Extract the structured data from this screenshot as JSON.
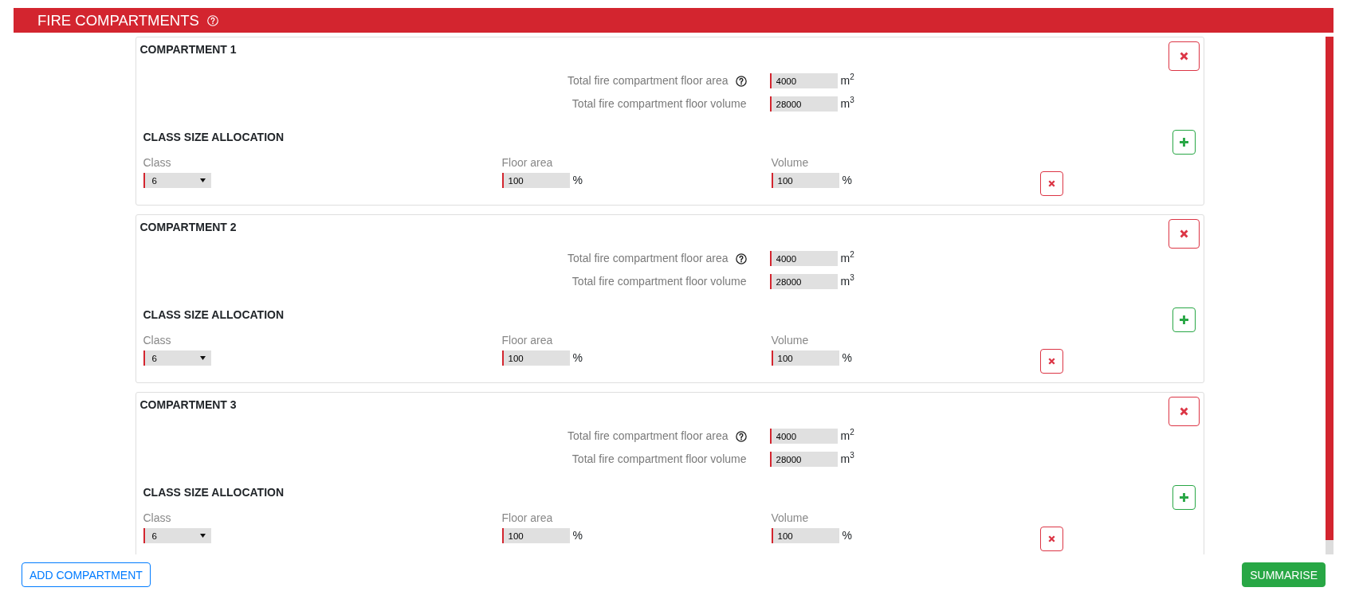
{
  "header": {
    "title": "FIRE COMPARTMENTS",
    "help": true
  },
  "compartments": [
    {
      "title": "COMPARTMENT 1",
      "totals": [
        {
          "label": "Total fire compartment floor area",
          "help": true,
          "value": "4000",
          "unit": "m$^{2}$"
        },
        {
          "label": "Total fire compartment floor volume",
          "help": false,
          "value": "28000",
          "unit": "m$^{3}$"
        }
      ],
      "allocation": {
        "title": "CLASS SIZE ALLOCATION",
        "columns": [
          "Class",
          "Floor area",
          "Volume"
        ],
        "rows": [
          {
            "cells": [
              {
                "kind": "select",
                "value": "6"
              },
              {
                "kind": "number",
                "value": "100",
                "unit": "%"
              },
              {
                "kind": "number",
                "value": "100",
                "unit": "%"
              }
            ]
          }
        ]
      }
    },
    {
      "title": "COMPARTMENT 2",
      "totals": [
        {
          "label": "Total fire compartment floor area",
          "help": true,
          "value": "4000",
          "unit": "m$^{2}$"
        },
        {
          "label": "Total fire compartment floor volume",
          "help": false,
          "value": "28000",
          "unit": "m$^{3}$"
        }
      ],
      "allocation": {
        "title": "CLASS SIZE ALLOCATION",
        "columns": [
          "Class",
          "Floor area",
          "Volume"
        ],
        "rows": [
          {
            "cells": [
              {
                "kind": "select",
                "value": "6"
              },
              {
                "kind": "number",
                "value": "100",
                "unit": "%"
              },
              {
                "kind": "number",
                "value": "100",
                "unit": "%"
              }
            ]
          }
        ]
      }
    },
    {
      "title": "COMPARTMENT 3",
      "totals": [
        {
          "label": "Total fire compartment floor area",
          "help": true,
          "value": "4000",
          "unit": "m$^{2}$"
        },
        {
          "label": "Total fire compartment floor volume",
          "help": false,
          "value": "28000",
          "unit": "m$^{3}$"
        }
      ],
      "allocation": {
        "title": "CLASS SIZE ALLOCATION",
        "columns": [
          "Class",
          "Floor area",
          "Volume"
        ],
        "rows": [
          {
            "cells": [
              {
                "kind": "select",
                "value": "6"
              },
              {
                "kind": "number",
                "value": "100",
                "unit": "%"
              },
              {
                "kind": "number",
                "value": "100",
                "unit": "%"
              }
            ]
          }
        ]
      }
    }
  ],
  "footer": {
    "add_button": "ADD COMPARTMENT",
    "summarise_button": "SUMMARISE"
  }
}
